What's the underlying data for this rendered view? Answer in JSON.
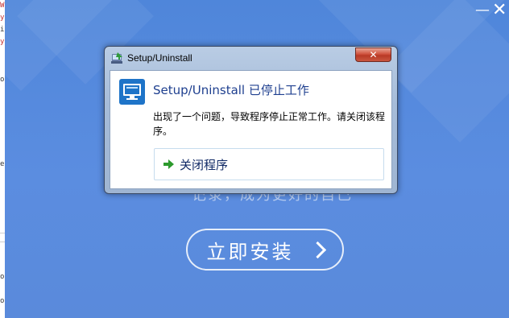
{
  "background_window": {
    "left_fragments": [
      "W",
      "y",
      "i",
      "y",
      "o",
      "e",
      "o",
      "o"
    ],
    "tagline": "记录，成为更好的自己",
    "install_button_label": "立即安装",
    "minimize_glyph": "—",
    "close_glyph": "✕"
  },
  "dialog": {
    "title": "Setup/Uninstall",
    "heading": "Setup/Uninstall 已停止工作",
    "message": "出现了一个问题，导致程序停止正常工作。请关闭该程序。",
    "action_label": "关闭程序",
    "close_glyph": "✕"
  },
  "icons": [
    "app-title-icon",
    "monitor-icon",
    "green-arrow-icon",
    "chevron-right-icon"
  ],
  "colors": {
    "installer_bg": "#5a8ddf",
    "dialog_frame": "#a6bcd9",
    "close_red": "#c9432f",
    "heading_blue": "#1e3f8f",
    "arrow_green": "#2d9a2d"
  }
}
